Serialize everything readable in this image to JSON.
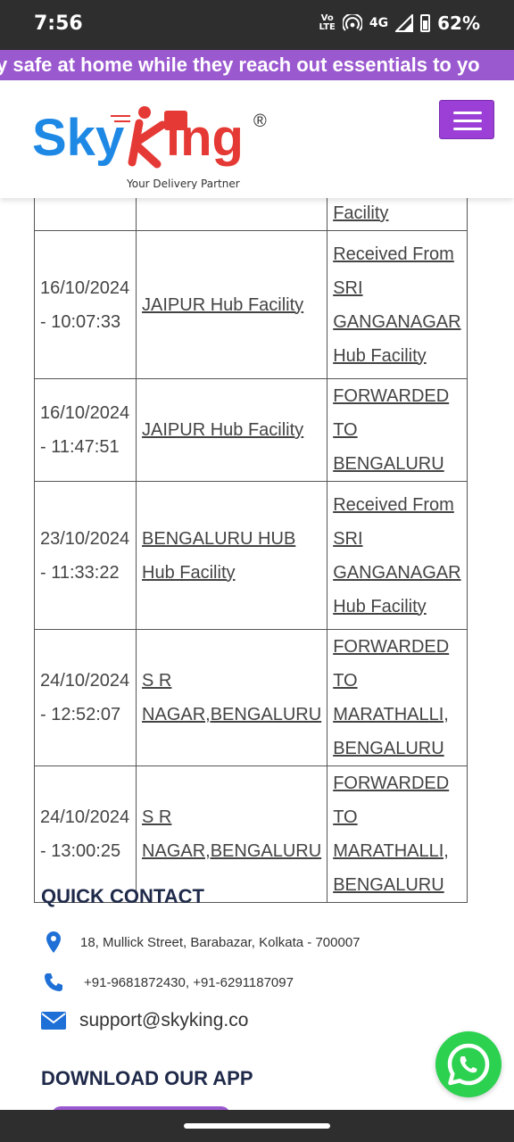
{
  "status_bar": {
    "time": "7:56",
    "volte_top": "Vo",
    "volte_bottom": "LTE",
    "network": "4G",
    "battery": "62%"
  },
  "ticker": {
    "text": "y safe at home while they reach out essentials to yo"
  },
  "header": {
    "logo_sky": "Sky",
    "logo_ing": "ing",
    "logo_reg": "®",
    "tagline": "Your Delivery Partner"
  },
  "tracking_table": {
    "partial_row": {
      "status": "Facility"
    },
    "rows": [
      {
        "date": "16/10/2024",
        "time": "- 10:07:33",
        "location": [
          "JAIPUR Hub Facility"
        ],
        "status": [
          "Received From",
          "SRI",
          "GANGANAGAR",
          "Hub Facility"
        ]
      },
      {
        "date": "16/10/2024",
        "time": "- 11:47:51",
        "location": [
          "JAIPUR Hub Facility"
        ],
        "status": [
          "FORWARDED TO",
          "BENGALURU"
        ]
      },
      {
        "date": "23/10/2024",
        "time": "- 11:33:22",
        "location": [
          "BENGALURU HUB",
          "Hub Facility"
        ],
        "status": [
          "Received From",
          "SRI",
          "GANGANAGAR",
          "Hub Facility"
        ]
      },
      {
        "date": "24/10/2024",
        "time": "- 12:52:07",
        "location": [
          "S R",
          "NAGAR,BENGALURU"
        ],
        "status": [
          "FORWARDED TO",
          "MARATHALLI,",
          "BENGALURU"
        ]
      },
      {
        "date": "24/10/2024",
        "time": "- 13:00:25",
        "location": [
          "S R",
          "NAGAR,BENGALURU"
        ],
        "status": [
          "FORWARDED TO",
          "MARATHALLI,",
          "BENGALURU"
        ]
      }
    ]
  },
  "quick_contact": {
    "title": "QUICK CONTACT",
    "address": "18, Mullick Street, Barabazar, Kolkata - 700007",
    "phone": "+91-9681872430, +91-6291187097",
    "email": "support@skyking.co"
  },
  "download": {
    "title": "DOWNLOAD OUR APP"
  },
  "colors": {
    "accent": "#9b59d0",
    "brand_blue": "#1e88e5",
    "brand_red": "#e53935",
    "whatsapp": "#2bd14f"
  },
  "icons": [
    "map-pin-icon",
    "phone-icon",
    "envelope-icon",
    "whatsapp-icon",
    "hamburger-menu-icon"
  ]
}
